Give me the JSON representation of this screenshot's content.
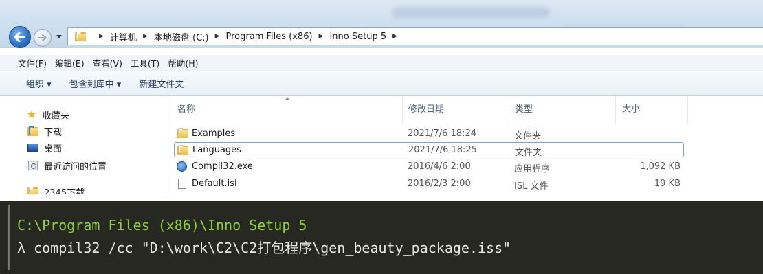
{
  "address": {
    "crumbs": [
      "计算机",
      "本地磁盘 (C:)",
      "Program Files (x86)",
      "Inno Setup 5"
    ]
  },
  "menu": [
    "文件(F)",
    "编辑(E)",
    "查看(V)",
    "工具(T)",
    "帮助(H)"
  ],
  "toolbar": {
    "organize": "组织 ▾",
    "include_library": "包含到库中 ▾",
    "new_folder": "新建文件夹"
  },
  "sidebar": {
    "favorites_label": "收藏夹",
    "items": [
      "下载",
      "桌面",
      "最近访问的位置",
      "2345下载"
    ]
  },
  "columns": {
    "name": "名称",
    "modified": "修改日期",
    "type": "类型",
    "size": "大小"
  },
  "files": [
    {
      "name": "Examples",
      "date": "2021/7/6 18:24",
      "type": "文件夹",
      "size": "",
      "icon": "folder-icon"
    },
    {
      "name": "Languages",
      "date": "2021/7/6 18:25",
      "type": "文件夹",
      "size": "",
      "icon": "folder-icon"
    },
    {
      "name": "Compil32.exe",
      "date": "2016/4/6 2:00",
      "type": "应用程序",
      "size": "1,092 KB",
      "icon": "exe-icon"
    },
    {
      "name": "Default.isl",
      "date": "2016/2/3 2:00",
      "type": "ISL 文件",
      "size": "19 KB",
      "icon": "document-icon"
    }
  ],
  "console": {
    "path_line": "C:\\Program Files (x86)\\Inno Setup 5",
    "command_line": "λ compil32 /cc \"D:\\work\\C2\\C2打包程序\\gen_beauty_package.iss\""
  },
  "colors": {
    "console_bg": "#272822",
    "console_path": "#8cd13c",
    "console_text": "#e8e8e2",
    "titlebar": "#cfe0f0"
  }
}
